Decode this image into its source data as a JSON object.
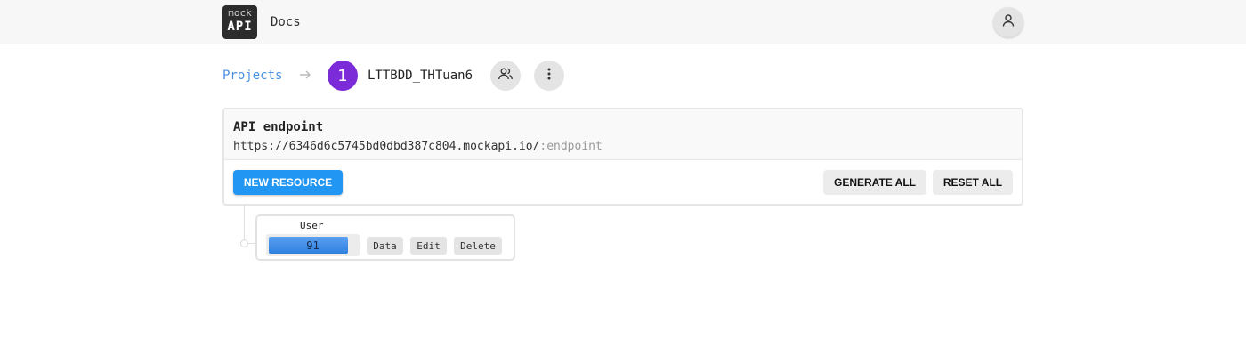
{
  "header": {
    "logo_top": "mock",
    "logo_bottom": "API",
    "docs_link": "Docs",
    "user_icon": "user-icon"
  },
  "breadcrumb": {
    "projects": "Projects",
    "separator_icon": "arrow-right-icon",
    "project_initial": "1",
    "project_name": "LTTBDD_THTuan6",
    "avatar_color": "#7b2bd8",
    "members_icon": "users-icon",
    "menu_icon": "more-vertical-icon"
  },
  "endpoint": {
    "title": "API endpoint",
    "url_base": "https://6346d6c5745bd0dbd387c804.mockapi.io/",
    "url_suffix": ":endpoint"
  },
  "actions": {
    "new_resource": "NEW RESOURCE",
    "generate_all": "GENERATE ALL",
    "reset_all": "RESET ALL",
    "accent_color": "#2196f3"
  },
  "resources": [
    {
      "name": "User",
      "count": "91",
      "fill_fraction": 0.9,
      "data_label": "Data",
      "edit_label": "Edit",
      "delete_label": "Delete"
    }
  ]
}
